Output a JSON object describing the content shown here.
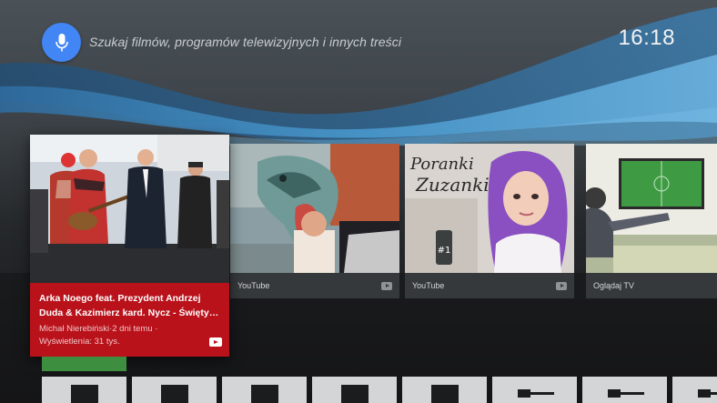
{
  "search": {
    "hint": "Szukaj filmów, programów telewizyjnych i innych treści",
    "icon": "mic-icon"
  },
  "clock": {
    "time": "16:18"
  },
  "colors": {
    "accent_mic": "#4285f4",
    "focused_card": "#b9121b",
    "card_footer": "#35393c"
  },
  "focused_card": {
    "title": "Arka Noego feat. Prezydent Andrzej Duda & Kazimierz kard. Nycz - Święty…",
    "meta_line1": "Michał Nierebiński·2 dni temu ·",
    "meta_line2": "Wyświetlenia: 31 tys.",
    "source_icon": "youtube-icon"
  },
  "cards": [
    {
      "source": "YouTube",
      "icon": "youtube-icon"
    },
    {
      "source": "YouTube",
      "icon": "youtube-icon"
    },
    {
      "source": "Oglądaj TV",
      "icon": ""
    }
  ],
  "thumbnail_text": {
    "poranki": "Poranki",
    "zuzanki": "Zuzanki",
    "hashtag": "#1"
  },
  "apps_row": [
    {
      "icon": "tv-screen-icon"
    },
    {
      "icon": "tv-screen-icon"
    },
    {
      "icon": "tv-screen-icon"
    },
    {
      "icon": "tv-screen-icon"
    },
    {
      "icon": "tv-screen-icon"
    },
    {
      "icon": "hdmi-cable-icon"
    },
    {
      "icon": "hdmi-cable-icon"
    },
    {
      "icon": "hdmi-cable-icon"
    }
  ]
}
